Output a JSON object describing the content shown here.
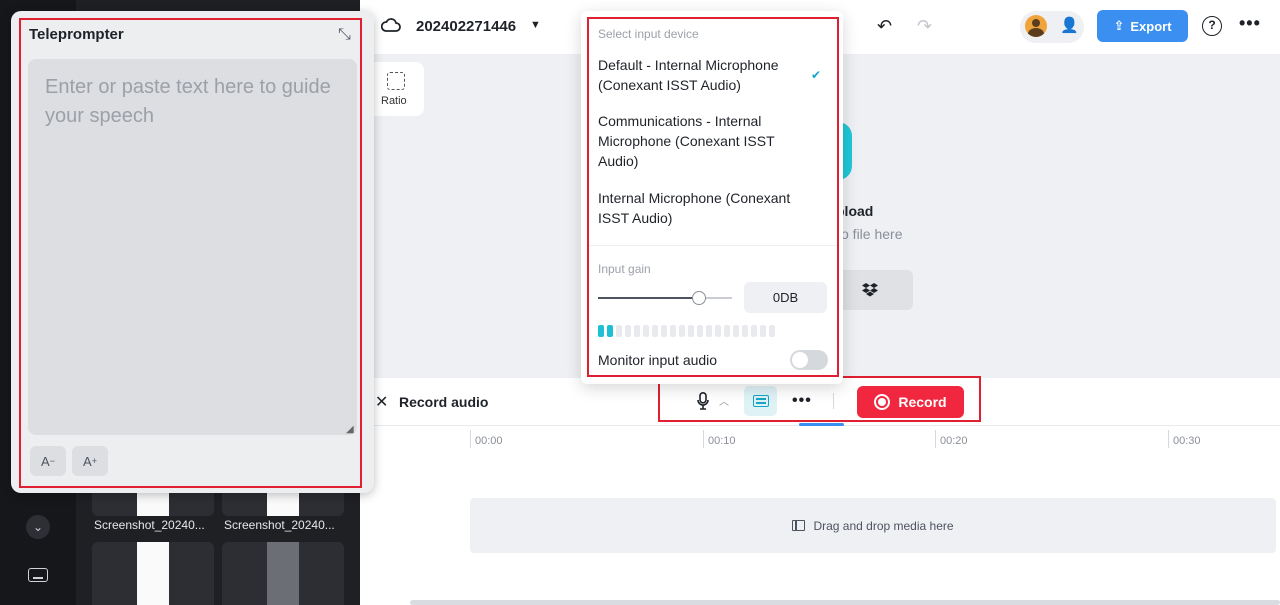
{
  "project": {
    "title": "202402271446"
  },
  "toolbar": {
    "export_label": "Export",
    "help_glyph": "?",
    "more_glyph": "•••"
  },
  "canvas": {
    "ratio_label": "Ratio",
    "upload_title": "pload",
    "upload_subtitle": "o file here"
  },
  "media": {
    "items": [
      {
        "label": "Screenshot_20240..."
      },
      {
        "label": "Screenshot_20240..."
      }
    ]
  },
  "teleprompter": {
    "title": "Teleprompter",
    "placeholder": "Enter or paste text here to guide your speech",
    "font_decrease": "A",
    "font_increase": "A"
  },
  "input_menu": {
    "heading": "Select input device",
    "devices": [
      {
        "label": "Default - Internal Microphone (Conexant ISST Audio)",
        "selected": true
      },
      {
        "label": "Communications - Internal Microphone (Conexant ISST Audio)",
        "selected": false
      },
      {
        "label": "Internal Microphone (Conexant ISST Audio)",
        "selected": false
      }
    ],
    "gain_heading": "Input gain",
    "gain_value": "0DB",
    "gain_slider_level": 0.75,
    "meter_segments_total": 20,
    "meter_segments_active": 2,
    "monitor_label": "Monitor input audio",
    "monitor_enabled": false
  },
  "record_bar": {
    "title": "Record audio",
    "record_label": "Record"
  },
  "timeline": {
    "ticks": [
      "00:00",
      "00:10",
      "00:20",
      "00:30"
    ],
    "drop_label": "Drag and drop media here"
  },
  "colors": {
    "accent": "#3b8ff0",
    "record": "#f0273e",
    "teal": "#1fc0d6",
    "highlight_outline": "#e02030"
  },
  "icons": {
    "cloud": "cloud-icon",
    "undo": "undo-icon",
    "redo": "redo-icon",
    "add_user": "add-user-icon",
    "help": "help-icon",
    "mic": "microphone-icon",
    "teleprompter": "teleprompter-icon",
    "close": "close-icon",
    "collapse": "collapse-icon",
    "check": "check-icon"
  }
}
